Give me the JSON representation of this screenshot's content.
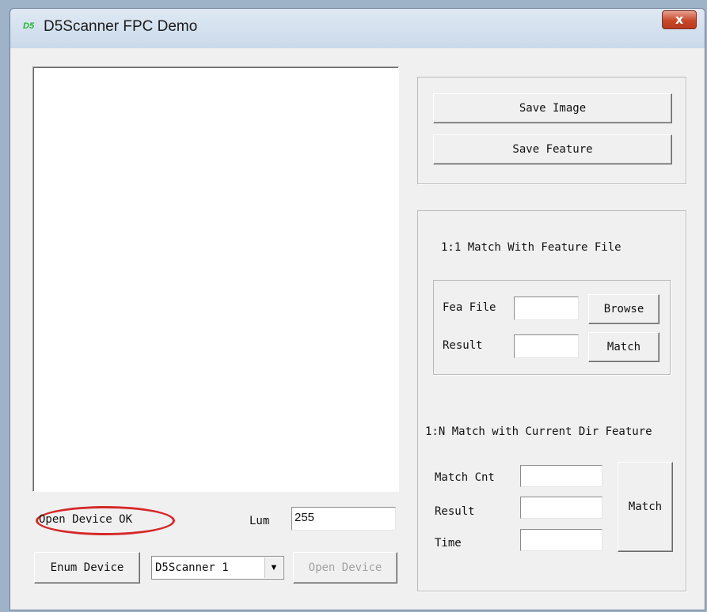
{
  "window": {
    "title": "D5Scanner FPC Demo",
    "logo_text": "D5",
    "close_glyph": "x"
  },
  "colors": {
    "status_highlight": "#d62828",
    "logo": "#2fae3a",
    "close_button": "#c8472a"
  },
  "export": {
    "save_image_label": "Save Image",
    "save_feature_label": "Save Feature"
  },
  "match_1_1": {
    "heading": "1:1 Match With Feature File",
    "fea_file_label": "Fea File",
    "fea_file_value": "",
    "browse_label": "Browse",
    "result_label": "Result",
    "result_value": "",
    "match_label": "Match"
  },
  "match_1_n": {
    "heading": "1:N Match with Current Dir Feature",
    "match_cnt_label": "Match Cnt",
    "match_cnt_value": "",
    "result_label": "Result",
    "result_value": "",
    "time_label": "Time",
    "time_value": "",
    "match_label": "Match"
  },
  "device": {
    "status_text": "Open Device OK",
    "lum_label": "Lum",
    "lum_value": "255",
    "enum_label": "Enum Device",
    "selected_device": "D5Scanner 1",
    "open_label": "Open Device"
  }
}
